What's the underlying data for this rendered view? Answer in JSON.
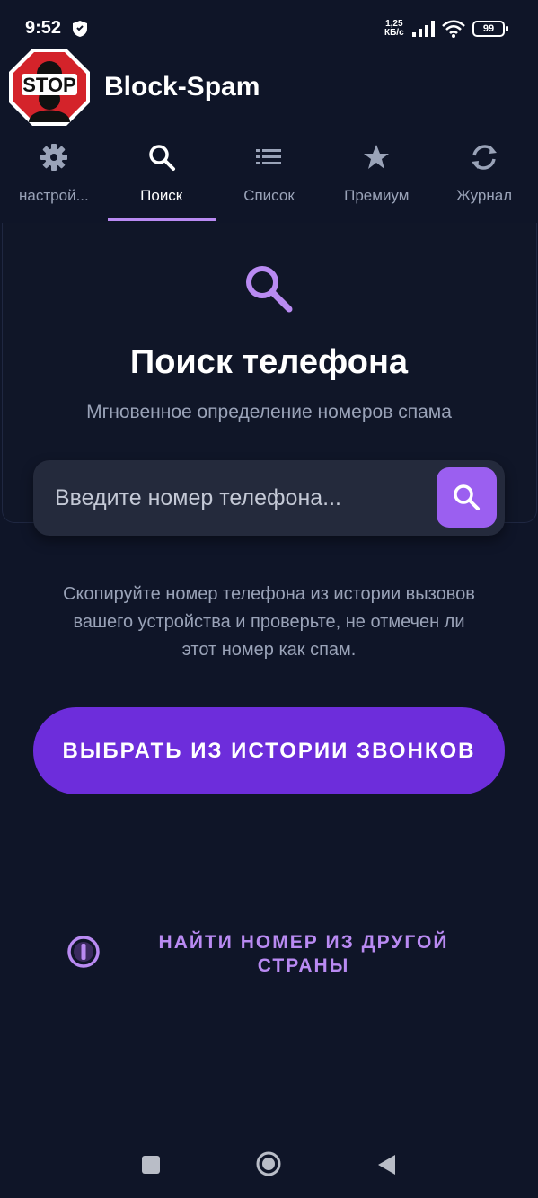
{
  "status_bar": {
    "time": "9:52",
    "net_speed_value": "1,25",
    "net_speed_unit": "КБ/с",
    "battery": "99",
    "icons": [
      "shield-icon",
      "signal-icon",
      "wifi-icon",
      "battery-icon"
    ]
  },
  "app": {
    "title": "Block-Spam",
    "logo_text": "STOP",
    "logo_icon": "stop-sign-logo"
  },
  "tabs": [
    {
      "label": "настрой...",
      "icon": "gear-icon",
      "active": false
    },
    {
      "label": "Поиск",
      "icon": "search-icon",
      "active": true
    },
    {
      "label": "Список",
      "icon": "list-icon",
      "active": false
    },
    {
      "label": "Премиум",
      "icon": "star-icon",
      "active": false
    },
    {
      "label": "Журнал",
      "icon": "sync-icon",
      "active": false
    }
  ],
  "search": {
    "title": "Поиск телефона",
    "subtitle": "Мгновенное определение номеров спама",
    "placeholder": "Введите номер телефона...",
    "value": "",
    "hint": "Скопируйте номер телефона из истории вызовов вашего устройства и проверьте, не отмечен ли этот номер как спам.",
    "history_button": "ВЫБРАТЬ ИЗ ИСТОРИИ ЗВОНКОВ",
    "other_country_line1": "НАЙТИ НОМЕР ИЗ ДРУГОЙ",
    "other_country_line2": "СТРАНЫ"
  },
  "colors": {
    "background": "#0f1528",
    "accent": "#b98af2",
    "primary_button": "#6d2ddb",
    "search_button": "#9b5ff0",
    "muted_text": "#9aa3b8"
  },
  "nav_bar": [
    "recents-button",
    "home-button",
    "back-button"
  ]
}
